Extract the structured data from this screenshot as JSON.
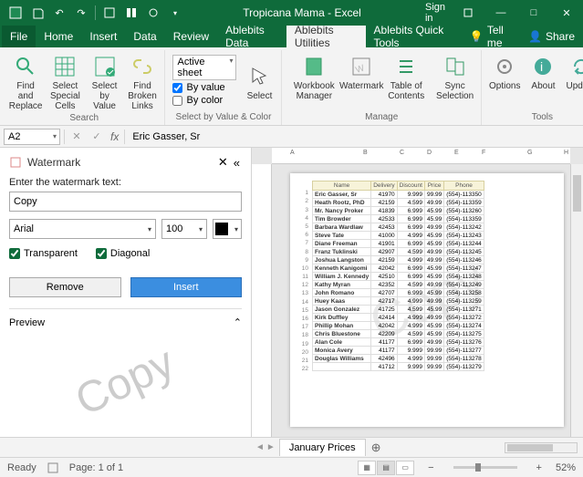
{
  "title": "Tropicana Mama - Excel",
  "signin": "Sign in",
  "menu": {
    "file": "File",
    "home": "Home",
    "insert": "Insert",
    "data": "Data",
    "review": "Review",
    "abdata": "Ablebits Data",
    "abutil": "Ablebits Utilities",
    "abquick": "Ablebits Quick Tools",
    "tellme": "Tell me",
    "share": "Share"
  },
  "ribbon": {
    "search_group": "Search",
    "find_replace": "Find and\nReplace",
    "select_special": "Select\nSpecial Cells",
    "select_value": "Select\nby Value",
    "find_broken": "Find Broken\nLinks",
    "svc_group": "Select by Value & Color",
    "active_sheet": "Active sheet",
    "by_value": "By value",
    "by_color": "By color",
    "select": "Select",
    "manage_group": "Manage",
    "workbook_mgr": "Workbook\nManager",
    "watermark": "Watermark",
    "toc": "Table of\nContents",
    "sync": "Sync\nSelection",
    "tools_group": "Tools",
    "options": "Options",
    "about": "About",
    "update": "Update"
  },
  "formula": {
    "cell": "A2",
    "fx": "fx",
    "value": "Eric Gasser, Sr"
  },
  "panel": {
    "title": "Watermark",
    "label": "Enter the watermark text:",
    "text": "Copy",
    "font": "Arial",
    "size": "100",
    "transparent": "Transparent",
    "diagonal": "Diagonal",
    "remove": "Remove",
    "insert": "Insert",
    "preview": "Preview",
    "wm": "Copy"
  },
  "sheet": {
    "tab": "January Prices",
    "headers": [
      "Name",
      "Delivery",
      "Discount",
      "Price",
      "Phone"
    ],
    "rows": [
      [
        "Eric Gasser, Sr",
        "41970",
        "9.999",
        "99.99",
        "(554)-113350"
      ],
      [
        "Heath Rootz, PhD",
        "42159",
        "4.599",
        "49.99",
        "(554)-113359"
      ],
      [
        "Mr. Nancy Proker",
        "41839",
        "6.999",
        "45.99",
        "(554)-113260"
      ],
      [
        "Tim Browder",
        "42533",
        "6.999",
        "45.99",
        "(554)-113359"
      ],
      [
        "Barbara Wardlaw",
        "42453",
        "6.999",
        "49.99",
        "(554)-113242"
      ],
      [
        "Steve Tate",
        "41000",
        "4.999",
        "45.99",
        "(554)-113243"
      ],
      [
        "Diane Freeman",
        "41901",
        "6.999",
        "45.99",
        "(554)-113244"
      ],
      [
        "Franz Tuklinski",
        "42907",
        "4.599",
        "49.99",
        "(554)-113245"
      ],
      [
        "Joshua Langston",
        "42159",
        "4.999",
        "49.99",
        "(554)-113246"
      ],
      [
        "Kenneth Kanigomi",
        "42042",
        "6.999",
        "45.99",
        "(554)-113247"
      ],
      [
        "William J. Kennedy",
        "42510",
        "6.999",
        "45.99",
        "(554)-113248"
      ],
      [
        "Kathy Myran",
        "42352",
        "4.599",
        "49.99",
        "(554)-113249"
      ],
      [
        "John Romano",
        "42707",
        "6.999",
        "45.99",
        "(554)-113258"
      ],
      [
        "Huey Kaas",
        "42717",
        "4.999",
        "49.99",
        "(554)-113259"
      ],
      [
        "Jason Gonzalez",
        "41725",
        "4.599",
        "45.99",
        "(554)-113271"
      ],
      [
        "Kirk Duffley",
        "42414",
        "4.999",
        "49.99",
        "(554)-113272"
      ],
      [
        "Phillip Mohan",
        "42042",
        "4.999",
        "45.99",
        "(554)-113274"
      ],
      [
        "Chris Bluestone",
        "42209",
        "4.599",
        "45.99",
        "(554)-113275"
      ],
      [
        "Alan Cole",
        "41177",
        "6.999",
        "49.99",
        "(554)-113276"
      ],
      [
        "Monica Avery",
        "41177",
        "9.999",
        "99.99",
        "(554)-113277"
      ],
      [
        "Douglas Williams",
        "42496",
        "4.999",
        "99.99",
        "(554)-113278"
      ],
      [
        "",
        "41712",
        "9.999",
        "99.99",
        "(554)-113279"
      ]
    ]
  },
  "status": {
    "ready": "Ready",
    "page": "Page: 1 of 1",
    "zoom": "52%"
  }
}
